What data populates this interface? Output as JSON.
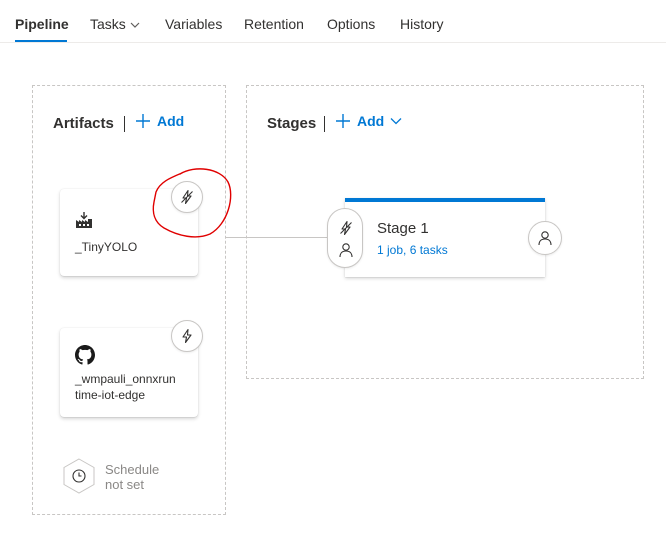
{
  "nav": {
    "tabs": [
      "Pipeline",
      "Tasks",
      "Variables",
      "Retention",
      "Options",
      "History"
    ]
  },
  "artifacts": {
    "title": "Artifacts",
    "add_label": "Add",
    "items": [
      {
        "name": "_TinyYOLO",
        "icon": "build-artifact-icon",
        "trigger_icon": "lightning-disabled-icon"
      },
      {
        "name_line1": "_wmpauli_onnxrun",
        "name_line2": "time-iot-edge",
        "icon": "github-icon",
        "trigger_icon": "lightning-icon"
      }
    ],
    "schedule_line1": "Schedule",
    "schedule_line2": "not set"
  },
  "stages": {
    "title": "Stages",
    "add_label": "Add",
    "items": [
      {
        "name": "Stage 1",
        "summary": "1 job, 6 tasks"
      }
    ]
  },
  "colors": {
    "accent": "#0078d4",
    "annotation": "#e00000",
    "border": "#c8c6c4"
  }
}
